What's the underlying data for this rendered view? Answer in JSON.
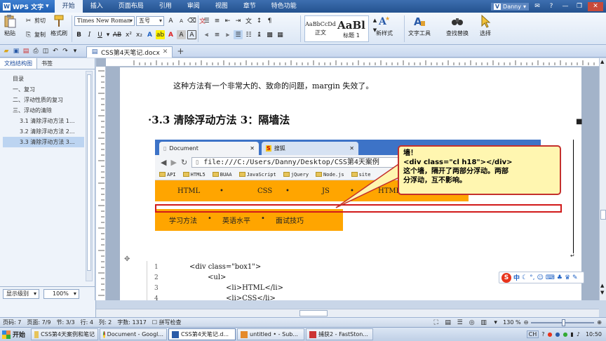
{
  "titlebar": {
    "app_name": "WPS 文字",
    "menus": [
      "开始",
      "插入",
      "页面布局",
      "引用",
      "审阅",
      "视图",
      "章节",
      "特色功能"
    ],
    "active_menu": "开始",
    "user": "Danny"
  },
  "ribbon": {
    "paste": "粘贴",
    "cut": "剪切",
    "copy": "复制",
    "format_painter": "格式刷",
    "font_name": "Times New Roman",
    "font_size": "五号",
    "styles": [
      {
        "sample": "AaBbCcDd",
        "label": "正文"
      },
      {
        "sample": "AaBl",
        "label": "标题 1"
      }
    ],
    "new_style": "新样式",
    "text_tools": "文字工具",
    "find_replace": "查找替换",
    "select": "选择"
  },
  "tabs": {
    "doc_tab": "CSS第4天笔记.docx"
  },
  "left_panel": {
    "tabs": [
      "文档结构图",
      "书签"
    ],
    "active_tab": "文档结构图",
    "outline": [
      {
        "text": "目录",
        "level": 0
      },
      {
        "text": "一、复习",
        "level": 1
      },
      {
        "text": "二、浮动性质的复习",
        "level": 1
      },
      {
        "text": "三、浮动的清除",
        "level": 1
      },
      {
        "text": "3.1 清除浮动方法 1...",
        "level": 2
      },
      {
        "text": "3.2 清除浮动方法 2...",
        "level": 2
      },
      {
        "text": "3.3 清除浮动方法 3...",
        "level": 2
      }
    ],
    "selected_index": 6,
    "display_level": "显示级别",
    "zoom": "100%"
  },
  "document": {
    "para1": "这种方法有一个非常大的、致命的问题，margin 失效了。",
    "heading": "3.3 清除浮动方法 3：隔墙法",
    "browser": {
      "tab1": "Document",
      "tab2": "搜狐",
      "url": "file:///C:/Users/Danny/Desktop/CSS第4天案例",
      "bookmarks": [
        "API",
        "HTML5",
        "BUAA",
        "JavaScript",
        "jQuery",
        "Node.js",
        "site"
      ],
      "nav1": [
        "HTML",
        "CSS",
        "JS",
        "HTML"
      ],
      "nav2": [
        "学习方法",
        "英语水平",
        "面试技巧"
      ]
    },
    "callout": {
      "line1": "墙！",
      "line2": "<div class=\"cl h18\"></div>",
      "line3": "这个墙，隔开了两部分浮动。两部",
      "line4": "分浮动，互不影响。"
    },
    "code": [
      {
        "num": "1",
        "text": "<div class=\"box1\">"
      },
      {
        "num": "2",
        "text": "<ul>"
      },
      {
        "num": "3",
        "text": "<li>HTML</li>"
      },
      {
        "num": "4",
        "text": "<li>CSS</li>"
      }
    ],
    "ime_char": "中"
  },
  "statusbar": {
    "page": "页码: 7",
    "pages": "页面: 7/9",
    "section": "节: 3/3",
    "row": "行: 4",
    "column": "列: 2",
    "words": "字数: 1317",
    "spell": "拼写检查",
    "zoom": "130 %"
  },
  "taskbar": {
    "start": "开始",
    "items": [
      "CSS第4天案例和笔记",
      "Document - Googl...",
      "CSS第4天笔记.d...",
      "untitled • - Sub...",
      "捕获2 - FastSton..."
    ],
    "active_index": 2,
    "lang": "CH",
    "time": "10:50"
  },
  "colors": {
    "accent": "#2a5ba8",
    "nav_orange": "#ffa500",
    "callout_border": "#c4302c",
    "callout_fill": "#fff6b0"
  }
}
